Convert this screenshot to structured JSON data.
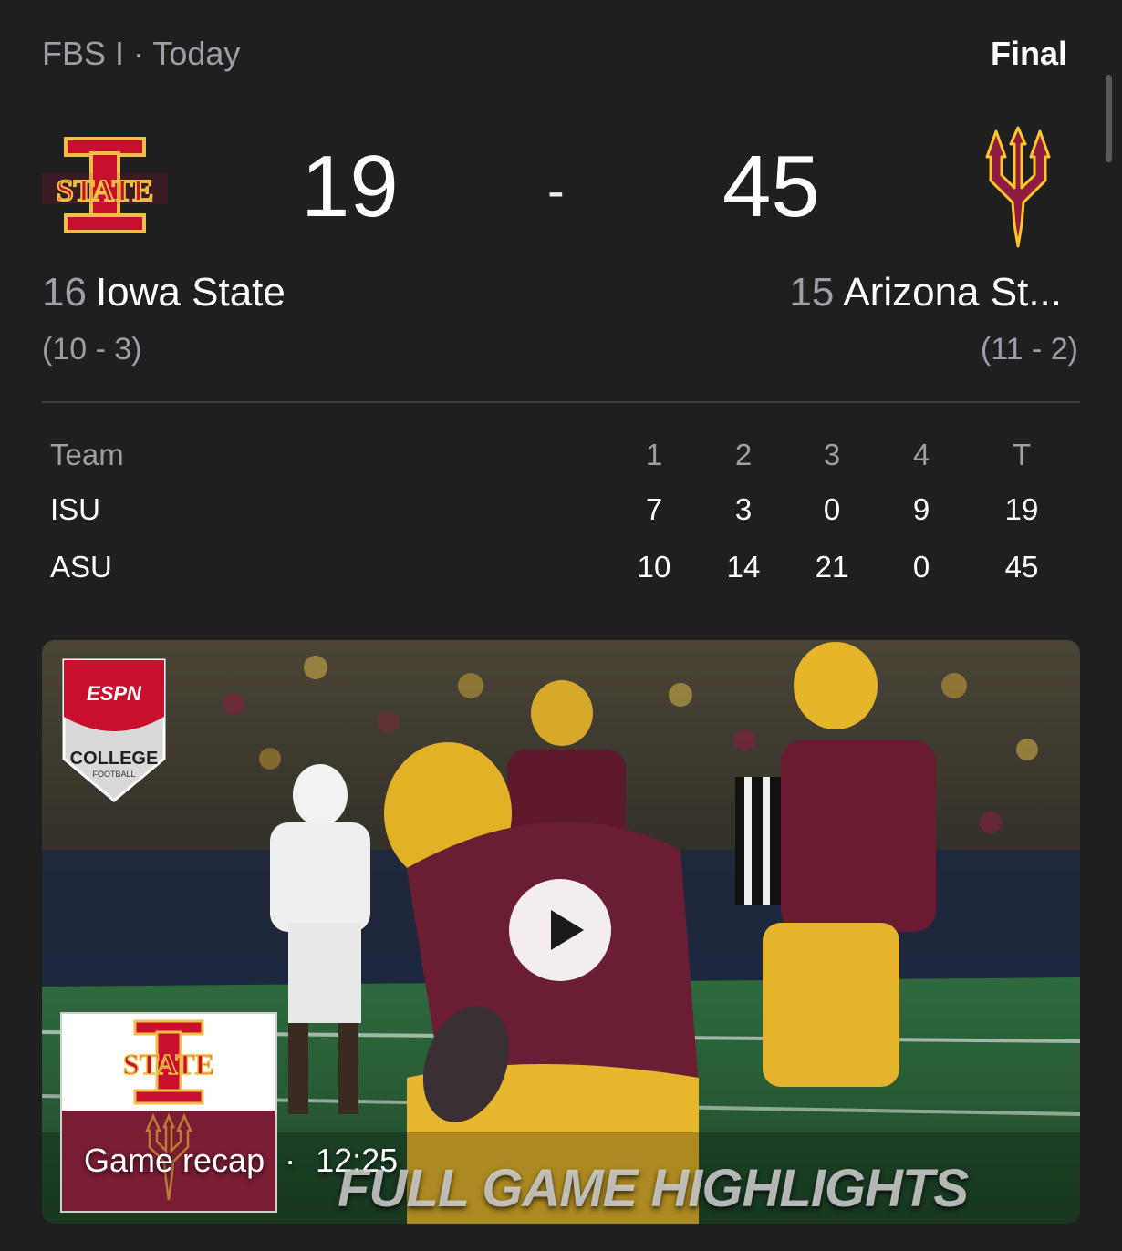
{
  "header": {
    "league": "FBS I · Today",
    "status": "Final"
  },
  "score": {
    "home": "19",
    "separator": "-",
    "away": "45"
  },
  "teams": {
    "home": {
      "rank": "16",
      "name": "Iowa State",
      "record": "(10 - 3)",
      "logo": "iowa-state-logo",
      "logo_text": "STATE"
    },
    "away": {
      "rank": "15",
      "name": "Arizona St...",
      "record": "(11 - 2)",
      "logo": "arizona-state-pitchfork-logo"
    }
  },
  "linescore": {
    "headers": [
      "Team",
      "1",
      "2",
      "3",
      "4",
      "T"
    ],
    "rows": [
      {
        "team": "ISU",
        "values": [
          "7",
          "3",
          "0",
          "9",
          "19"
        ]
      },
      {
        "team": "ASU",
        "values": [
          "10",
          "14",
          "21",
          "0",
          "45"
        ]
      }
    ]
  },
  "video": {
    "label": "Game recap",
    "separator": "·",
    "duration": "12:25",
    "overlay_text": "FULL GAME HIGHLIGHTS",
    "badge_top": "ESPN",
    "badge_bottom": "COLLEGE",
    "badge_sub": "FOOTBALL",
    "play_icon": "play-icon"
  },
  "colors": {
    "background": "#1f1f1f",
    "isu_cardinal": "#c8102e",
    "isu_gold": "#f1be48",
    "asu_maroon": "#8c1d40",
    "asu_gold": "#ffc627"
  }
}
